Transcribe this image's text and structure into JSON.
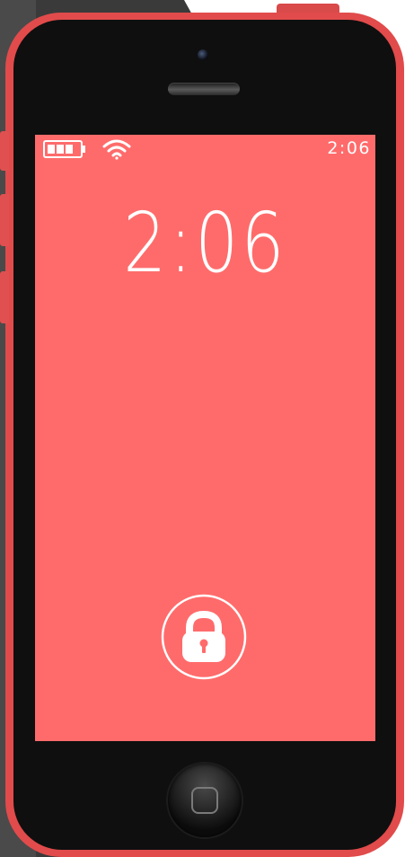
{
  "status_bar": {
    "time": "2:06",
    "battery_icon": "battery-icon",
    "wifi_icon": "wifi-icon"
  },
  "lock_screen": {
    "clock_time": "2:06",
    "unlock_icon": "padlock-icon"
  },
  "device": {
    "home_button_icon": "home-button-square-icon"
  },
  "colors": {
    "screen_background": "#ff6b6b",
    "phone_shell": "#e14b4b",
    "bezel": "#0f0f0f",
    "text": "#ffffff"
  }
}
